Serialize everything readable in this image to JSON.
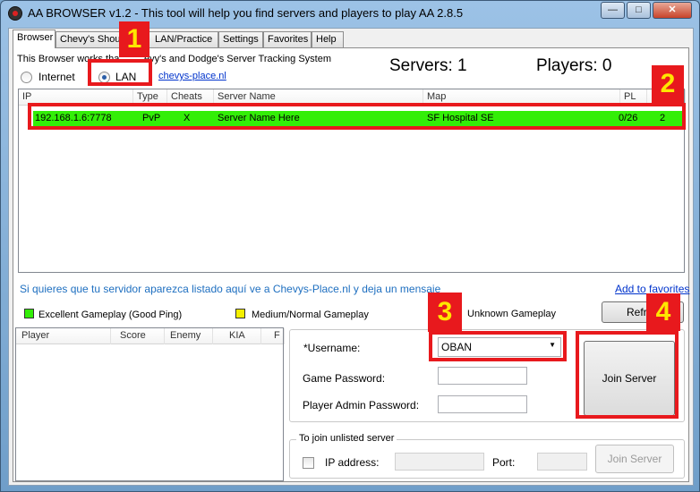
{
  "window": {
    "title": "AA BROWSER v1.2 - This tool will help you find servers and players to play AA 2.8.5",
    "minimize_glyph": "—",
    "maximize_glyph": "□",
    "close_glyph": "✕"
  },
  "tabs": [
    {
      "label": "Browser",
      "active": true
    },
    {
      "label": "Chevy's Shout"
    },
    {
      "label": "LAN/Practice"
    },
    {
      "label": "Settings"
    },
    {
      "label": "Favorites"
    },
    {
      "label": "Help"
    }
  ],
  "browser": {
    "info_text": "This Browser works tha",
    "info_text_tail": "evy's and Dodge's Server Tracking System",
    "radio_internet": "Internet",
    "radio_lan": "LAN",
    "selected_mode": "LAN",
    "site_link": "chevys-place.nl",
    "servers_count": "Servers: 1",
    "players_count": "Players: 0"
  },
  "server_list": {
    "columns": [
      "IP",
      "Type",
      "Cheats",
      "Server Name",
      "Map",
      "PL",
      ""
    ],
    "rows": [
      {
        "ip": "192.168.1.6:7778",
        "type": "PvP",
        "cheats": "X",
        "name": "Server Name Here",
        "map": "SF Hospital SE",
        "pl": "0/26",
        "extra": "2"
      }
    ]
  },
  "notice": {
    "message": "Si quieres que tu servidor aparezca listado aquí ve a Chevys-Place.nl y deja un mensaje",
    "add_favorites": "Add to favorites"
  },
  "legend": {
    "excellent": "Excellent Gameplay (Good Ping)",
    "medium": "Medium/Normal Gameplay",
    "unknown": "Unknown Gameplay",
    "excellent_color": "#33ee08",
    "medium_color": "#f5f000",
    "refresh_label": "Refre"
  },
  "player_list": {
    "columns": [
      "Player",
      "Score",
      "Enemy",
      "KIA",
      "F"
    ]
  },
  "join": {
    "username_label": "*Username:",
    "username_value": "OBAN",
    "game_password_label": "Game Password:",
    "admin_password_label": "Player Admin Password:",
    "join_button": "Join Server"
  },
  "unlisted": {
    "group_label": "To join unlisted server",
    "ip_label": "IP address:",
    "port_label": "Port:",
    "join_button": "Join Server"
  },
  "callouts": {
    "one": "1",
    "two": "2",
    "three": "3",
    "four": "4",
    "color": "#e8191d",
    "number_color": "#ffe600"
  }
}
